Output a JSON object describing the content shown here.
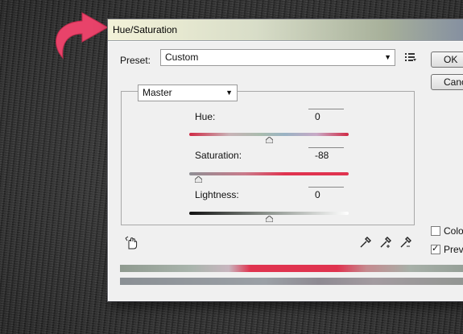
{
  "dialog": {
    "title": "Hue/Saturation",
    "preset_label": "Preset:",
    "preset_value": "Custom",
    "ok_label": "OK",
    "cancel_label": "Cancel",
    "channel_value": "Master",
    "adjustments": [
      {
        "label": "Hue:",
        "value": "0",
        "level": 0.5
      },
      {
        "label": "Saturation:",
        "value": "-88",
        "level": 0.06
      },
      {
        "label": "Lightness:",
        "value": "0",
        "level": 0.5
      }
    ],
    "colorize_label": "Colorize",
    "colorize_checked": false,
    "preview_label": "Preview",
    "preview_checked": true
  },
  "icons": {
    "pointer_arrow": "curved-arrow-icon",
    "preset_options": "preset-options-icon",
    "targeted_adjust": "hand-adjust-icon",
    "eyedropper": "eyedropper-icon",
    "eyedropper_add": "eyedropper-plus-icon",
    "eyedropper_subtract": "eyedropper-minus-icon"
  },
  "colors": {
    "accent_arrow": "#e8436a",
    "spectrum_red": "#e0334f",
    "title_gradient_start": "#f3f2d8",
    "title_gradient_end": "#7f8aa2"
  }
}
